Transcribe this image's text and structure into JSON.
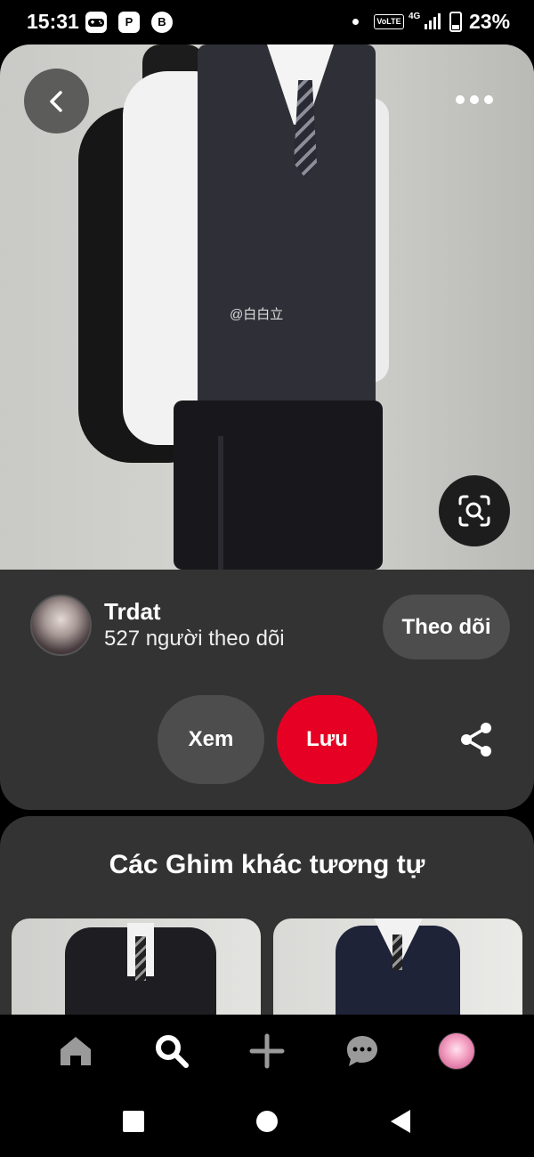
{
  "status_bar": {
    "time": "15:31",
    "app_icons": [
      "gamepad-icon",
      "parking-app-icon",
      "bitcoin-icon"
    ],
    "volte": "VoLTE",
    "network": "4G",
    "battery": "23%",
    "battery_level": 0.23
  },
  "pin": {
    "watermark": "@白白立",
    "icons": {
      "back": "chevron-left-icon",
      "more": "more-dots-icon",
      "visual_search": "visual-search-icon"
    }
  },
  "creator": {
    "name": "Trdat",
    "followers": "527 người theo dõi",
    "follow_label": "Theo dõi"
  },
  "actions": {
    "view_label": "Xem",
    "save_label": "Lưu",
    "share_icon": "share-icon",
    "save_color": "#e60023"
  },
  "related": {
    "title": "Các Ghim khác tương tự"
  },
  "bottom_nav": {
    "items": [
      "home-icon",
      "search-icon",
      "create-plus-icon",
      "messages-icon",
      "profile-avatar"
    ]
  },
  "system_nav": {
    "items": [
      "recents-square-icon",
      "home-circle-icon",
      "back-triangle-icon"
    ]
  }
}
